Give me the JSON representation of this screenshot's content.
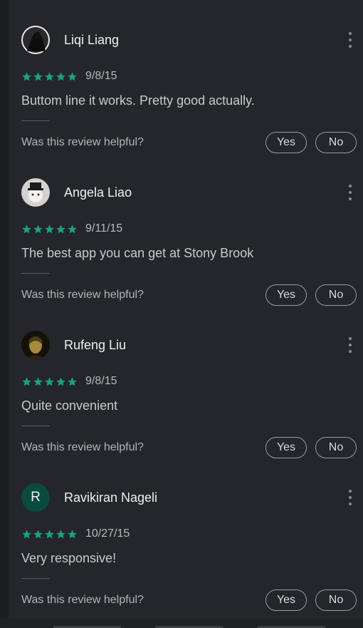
{
  "helpful_prompt": "Was this review helpful?",
  "yes_label": "Yes",
  "no_label": "No",
  "reviews": [
    {
      "name": "Liqi Liang",
      "stars": 5,
      "date": "9/8/15",
      "text": "Buttom line it works. Pretty good actually.",
      "avatar": "photo-dark-figure"
    },
    {
      "name": "Angela Liao",
      "stars": 5,
      "date": "9/11/15",
      "text": "The best app you can get at Stony Brook",
      "avatar": "photo-hat-figure"
    },
    {
      "name": "Rufeng Liu",
      "stars": 5,
      "date": "9/8/15",
      "text": "Quite convenient",
      "avatar": "photo-portrait"
    },
    {
      "name": "Ravikiran Nageli",
      "stars": 5,
      "date": "10/27/15",
      "text": "Very responsive!",
      "avatar": "letter",
      "initial": "R"
    }
  ],
  "colors": {
    "star": "#1aa37a",
    "letter_avatar_bg": "#0b4a3f"
  }
}
